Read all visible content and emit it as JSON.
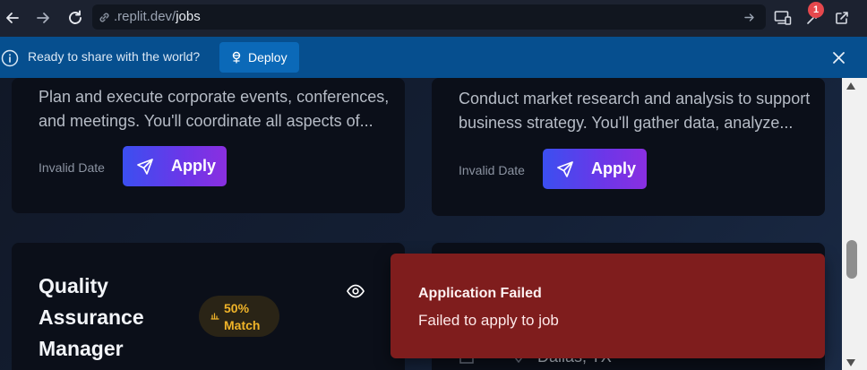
{
  "browser": {
    "url_host": ".replit.dev/",
    "url_path": "jobs",
    "extension_badge": "1"
  },
  "banner": {
    "message": "Ready to share with the world?",
    "deploy_label": "Deploy"
  },
  "cards": [
    {
      "description": "Plan and execute corporate events, conferences, and meetings. You'll coordinate all aspects of...",
      "date": "Invalid Date",
      "apply_label": "Apply"
    },
    {
      "description": "Conduct market research and analysis to support business strategy. You'll gather data, analyze...",
      "date": "Invalid Date",
      "apply_label": "Apply"
    }
  ],
  "job": {
    "title": "Quality Assurance Manager",
    "match_percent": "50%",
    "match_label": "Match",
    "location": "Dallas, TX"
  },
  "toast": {
    "title": "Application Failed",
    "message": "Failed to apply to job"
  },
  "colors": {
    "banner": "#064f8f",
    "apply_gradient_start": "#3b4ff0",
    "apply_gradient_end": "#8a2fe0",
    "toast": "#7f1d1d",
    "match_text": "#f0b429"
  },
  "icons": [
    "back-icon",
    "forward-icon",
    "reload-icon",
    "link-icon",
    "arrow-right-icon",
    "devices-icon",
    "extension-icon",
    "open-external-icon",
    "info-icon",
    "deploy-icon",
    "close-icon",
    "send-icon",
    "chart-icon",
    "eye-icon",
    "map-pin-icon",
    "building-icon"
  ]
}
